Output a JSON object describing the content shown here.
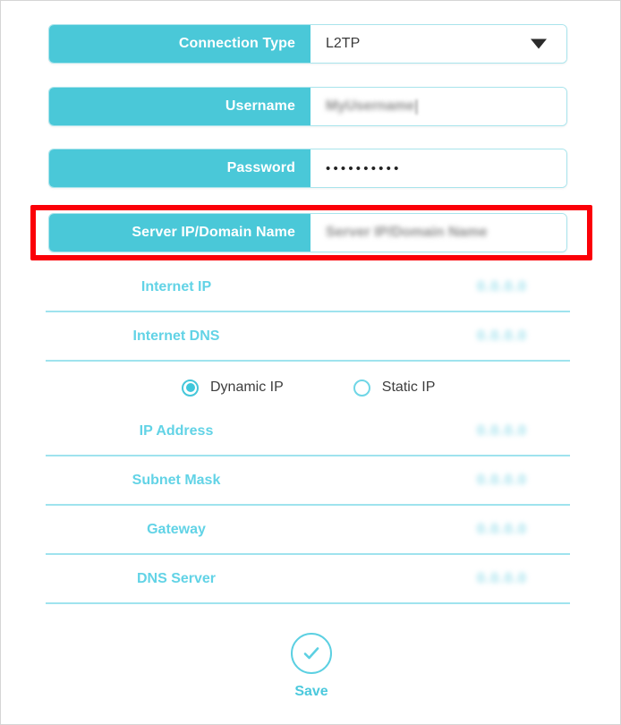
{
  "form": {
    "fields": [
      {
        "label": "Connection Type",
        "value": "L2TP",
        "kind": "select",
        "name": "connection-type"
      },
      {
        "label": "Username",
        "value": "MyUsername",
        "kind": "text-redacted",
        "name": "username"
      },
      {
        "label": "Password",
        "value": "••••••••••",
        "kind": "password",
        "name": "password"
      },
      {
        "label": "Server IP/Domain Name",
        "value": "Server IP/Domain Name",
        "kind": "text-placeholder",
        "name": "server-ip-domain-name"
      }
    ],
    "info_rows": [
      {
        "label": "Internet IP",
        "value": "0.0.0.0",
        "name": "internet-ip"
      },
      {
        "label": "Internet DNS",
        "value": "0.0.0.0",
        "name": "internet-dns"
      }
    ],
    "ip_mode": {
      "options": [
        {
          "label": "Dynamic IP",
          "selected": true,
          "name": "dynamic-ip"
        },
        {
          "label": "Static IP",
          "selected": false,
          "name": "static-ip"
        }
      ]
    },
    "static_rows": [
      {
        "label": "IP Address",
        "value": "0.0.0.0",
        "name": "ip-address"
      },
      {
        "label": "Subnet Mask",
        "value": "0.0.0.0",
        "name": "subnet-mask"
      },
      {
        "label": "Gateway",
        "value": "0.0.0.0",
        "name": "gateway"
      },
      {
        "label": "DNS Server",
        "value": "0.0.0.0",
        "name": "dns-server"
      }
    ],
    "save": {
      "label": "Save",
      "icon": "check-circle-icon"
    },
    "highlight": {
      "target": "Server IP/Domain Name",
      "color": "#FB0007"
    },
    "colors": {
      "accent": "#4AC8D8",
      "label_text": "#62D3E6",
      "divider": "#9FE3EE",
      "highlight": "#FB0007"
    }
  }
}
